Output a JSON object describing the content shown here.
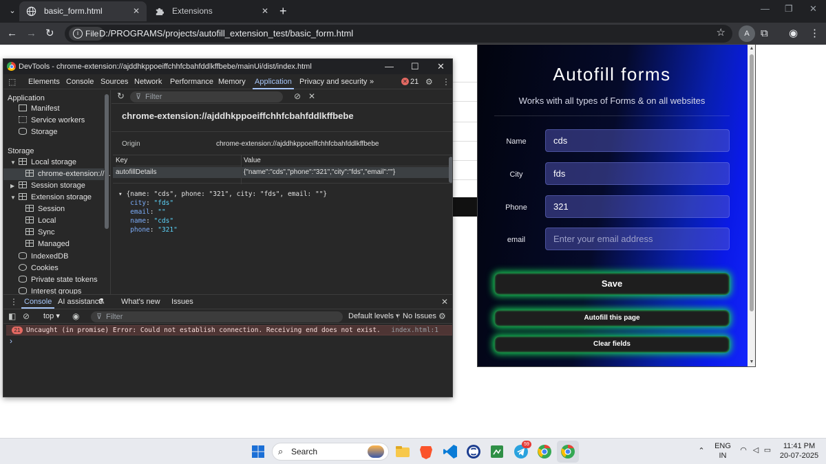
{
  "browser": {
    "tabs": [
      {
        "title": "basic_form.html",
        "active": true
      },
      {
        "title": "Extensions",
        "active": false
      }
    ],
    "omnibox": {
      "scheme_chip": "File",
      "url": "D:/PROGRAMS/projects/autofill_extension_test/basic_form.html"
    },
    "profile_initial": "A"
  },
  "devtools": {
    "window_title": "DevTools - chrome-extension://ajddhkppoeiffchhfcbahfddlkffbebe/mainUi/dist/index.html",
    "tabs": [
      "Elements",
      "Console",
      "Sources",
      "Network",
      "Performance",
      "Memory",
      "Application",
      "Privacy and security"
    ],
    "active_tab": "Application",
    "error_count": "21",
    "sidebar": {
      "application_header": "Application",
      "application_items": [
        "Manifest",
        "Service workers",
        "Storage"
      ],
      "storage_header": "Storage",
      "local_storage": "Local storage",
      "local_storage_child": "chrome-extension://...",
      "session_storage": "Session storage",
      "extension_storage": "Extension storage",
      "extension_children": [
        "Session",
        "Local",
        "Sync",
        "Managed"
      ],
      "other_items": [
        "IndexedDB",
        "Cookies",
        "Private state tokens",
        "Interest groups"
      ]
    },
    "main": {
      "filter_placeholder": "Filter",
      "origin_title": "chrome-extension://ajddhkppoeiffchhfcbahfddlkffbebe",
      "origin_label": "Origin",
      "origin_value": "chrome-extension://ajddhkppoeiffchhfcbahfddlkffbebe",
      "table_headers": [
        "Key",
        "Value"
      ],
      "row": {
        "key": "autofillDetails",
        "value": "{\"name\":\"cds\",\"phone\":\"321\",\"city\":\"fds\",\"email\":\"\"}"
      },
      "preview_summary": "{name: \"cds\", phone: \"321\", city: \"fds\", email: \"\"}",
      "preview_props": [
        {
          "key": "city",
          "value": "\"fds\""
        },
        {
          "key": "email",
          "value": "\"\""
        },
        {
          "key": "name",
          "value": "\"cds\""
        },
        {
          "key": "phone",
          "value": "\"321\""
        }
      ]
    },
    "drawer": {
      "tabs": [
        "Console",
        "AI assistance",
        "What's new",
        "Issues"
      ],
      "active_tab": "Console",
      "context": "top",
      "filter_placeholder": "Filter",
      "levels": "Default levels",
      "issues": "No Issues",
      "error": {
        "count": "21",
        "message": "Uncaught (in promise) Error: Could not establish connection. Receiving end does not exist.",
        "source": "index.html:1"
      },
      "prompt": "›"
    }
  },
  "popup": {
    "title": "Autofill forms",
    "subtitle": "Works with all types of Forms & on all websites",
    "fields": [
      {
        "label": "Name",
        "value": "cds",
        "placeholder": ""
      },
      {
        "label": "City",
        "value": "fds",
        "placeholder": ""
      },
      {
        "label": "Phone",
        "value": "321",
        "placeholder": ""
      },
      {
        "label": "email",
        "value": "",
        "placeholder": "Enter your email address"
      }
    ],
    "save_label": "Save",
    "autofill_label": "Autofill this page",
    "clear_label": "Clear fields"
  },
  "taskbar": {
    "search_label": "Search",
    "language": "ENG",
    "region": "IN",
    "time": "11:41 PM",
    "date": "20-07-2025",
    "telegram_badge": "59"
  },
  "colors": {
    "accent_blue": "#a8c7fa",
    "error_red": "#e46962",
    "glow_green": "#18d85a",
    "popup_blue": "#1527ff"
  }
}
